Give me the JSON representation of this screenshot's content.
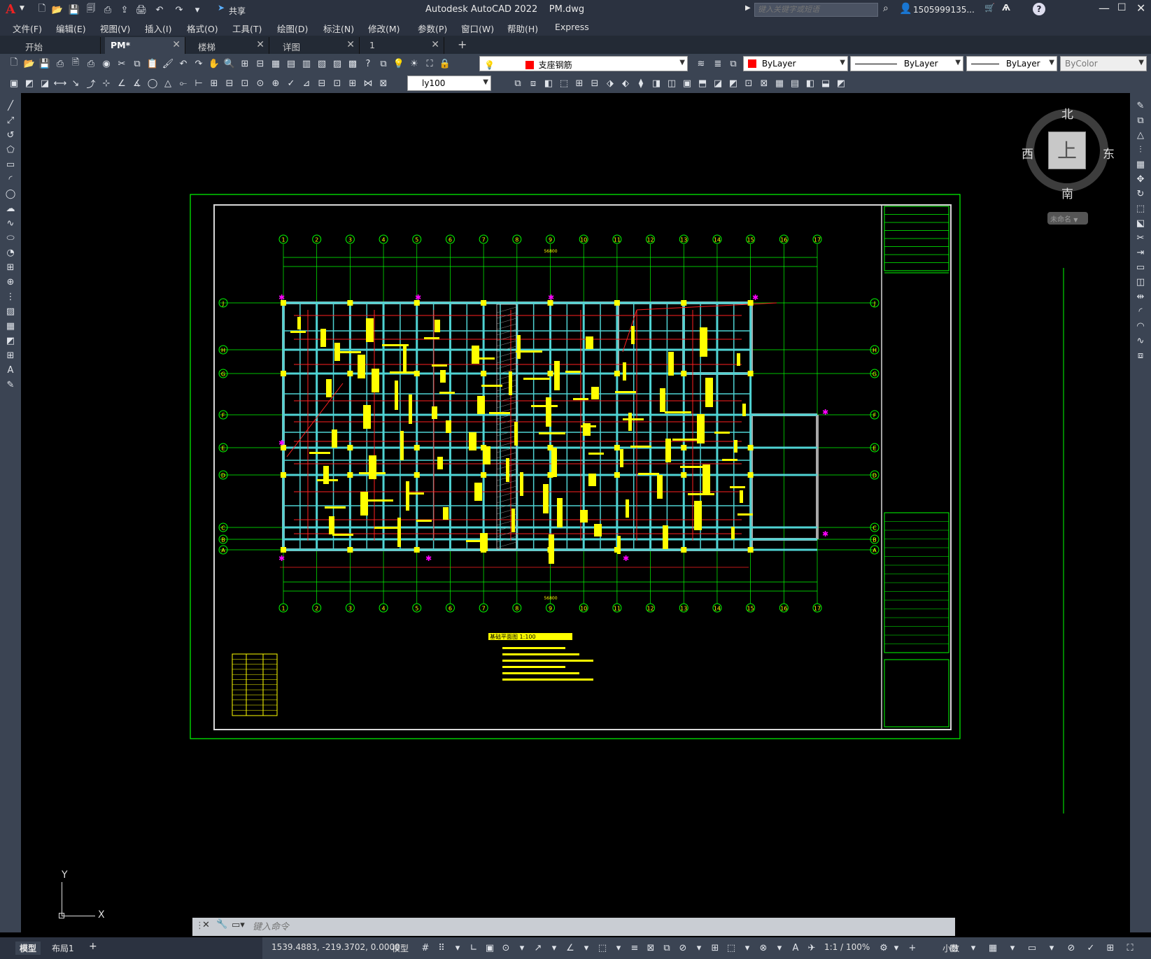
{
  "title": {
    "app": "Autodesk AutoCAD 2022",
    "file": "PM.dwg",
    "share": "共享",
    "search_placeholder": "键入关键字或短语",
    "user": "1505999135...",
    "app_logo": "A"
  },
  "menu": [
    "文件(F)",
    "编辑(E)",
    "视图(V)",
    "插入(I)",
    "格式(O)",
    "工具(T)",
    "绘图(D)",
    "标注(N)",
    "修改(M)",
    "参数(P)",
    "窗口(W)",
    "帮助(H)",
    "Express"
  ],
  "tabs": [
    {
      "label": "开始"
    },
    {
      "label": "PM*"
    },
    {
      "label": "楼梯"
    },
    {
      "label": "详图"
    },
    {
      "label": "1"
    }
  ],
  "layer": {
    "name": "支座钢筋",
    "color": "#ff0000"
  },
  "props": {
    "color": "ByLayer",
    "linetype": "ByLayer",
    "lineweight": "ByLayer",
    "plotstyle": "ByColor"
  },
  "dimstyle": "ly100",
  "viewcube": {
    "north": "北",
    "south": "南",
    "east": "东",
    "west": "西",
    "top": "上",
    "wcs": "未命名"
  },
  "ucs": {
    "y": "Y",
    "x": "X"
  },
  "command": {
    "placeholder": "键入命令"
  },
  "layout_tabs": [
    "模型",
    "布局1"
  ],
  "status": {
    "coords": "1539.4883, -219.3702, 0.0000",
    "model": "模型",
    "scale": "1:1 / 100%",
    "units": "小数"
  },
  "drawing": {
    "grid_top": [
      "1",
      "2",
      "3",
      "4",
      "5",
      "6",
      "7",
      "8",
      "9",
      "10",
      "11",
      "12",
      "13",
      "14",
      "15",
      "16",
      "17"
    ],
    "grid_rows": [
      "J",
      "H",
      "G",
      "F",
      "E",
      "D",
      "C",
      "B",
      "A"
    ],
    "total_dim": "56800",
    "plan_title": "基础平面图 1:100"
  },
  "colors": {
    "accent": "#2b8ce6",
    "cad_green": "#00ff00",
    "cad_yellow": "#ffff00",
    "cad_red": "#ff2020",
    "cad_cyan": "#4fd3d3",
    "cad_magenta": "#ff00ff"
  }
}
